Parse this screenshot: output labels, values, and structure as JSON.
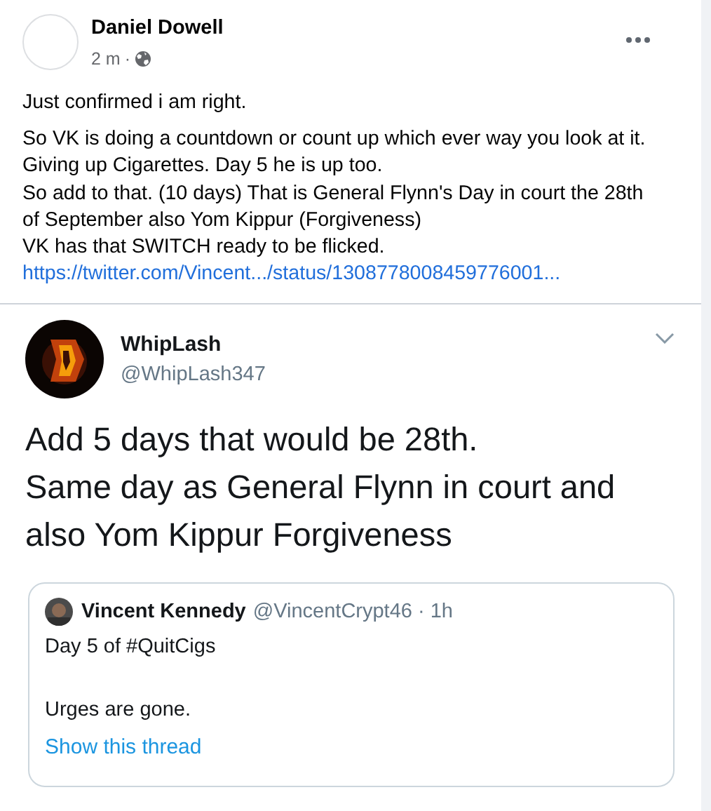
{
  "post": {
    "author": "Daniel Dowell",
    "time": "2 m",
    "separator": "·",
    "paragraphs": [
      "Just confirmed i am right.",
      "So VK is doing a countdown or count up which ever way you look at it.\nGiving up Cigarettes. Day 5 he is up too.\nSo add to that. (10 days) That is General Flynn's Day in court the 28th\nof September also Yom Kippur (Forgiveness)\nVK has that SWITCH ready to be flicked."
    ],
    "link": "https://twitter.com/Vincent.../status/1308778008459776001..."
  },
  "tweet": {
    "name": "WhipLash",
    "handle": "@WhipLash347",
    "lines": [
      "Add 5 days that would be 28th.",
      "Same day as General Flynn in court and",
      "also Yom Kippur Forgiveness"
    ],
    "quote": {
      "name": "Vincent Kennedy",
      "handle": "@VincentCrypt46 · 1h",
      "paragraphs": [
        "Day 5 of #QuitCigs",
        "Urges are gone."
      ],
      "thread_link": "Show this thread"
    }
  }
}
